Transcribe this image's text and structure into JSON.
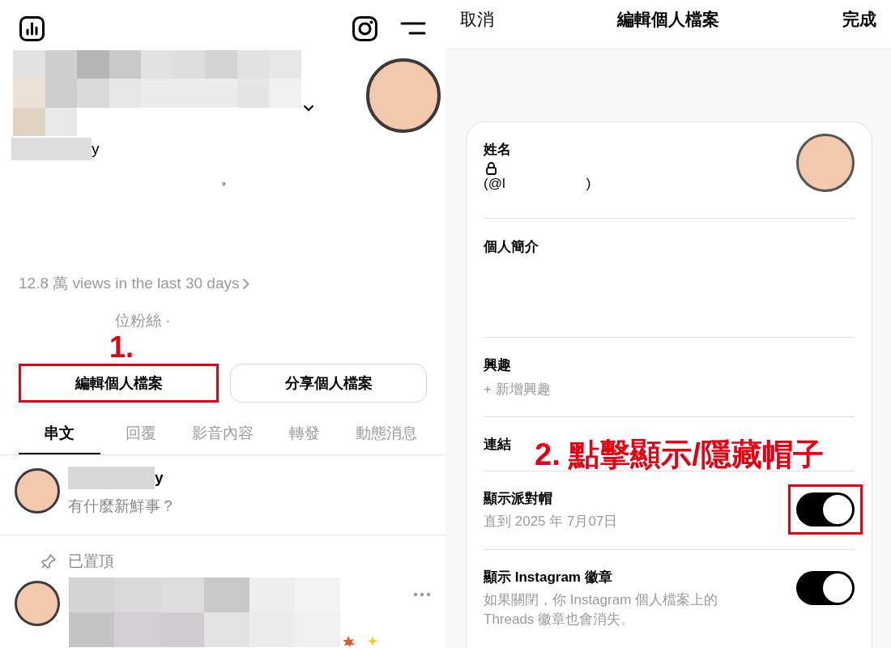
{
  "profile": {
    "name_suffix": "y",
    "bio": "。",
    "views": "12.8 萬 views in the last 30 days",
    "followers": "位粉絲 ·",
    "annotation": "1."
  },
  "profile_buttons": [
    {
      "label": "編輯個人檔案",
      "highlighted": true
    },
    {
      "label": "分享個人檔案",
      "highlighted": false
    }
  ],
  "tabs": [
    {
      "label": "串文",
      "selected": true
    },
    {
      "label": "回覆",
      "selected": false
    },
    {
      "label": "影音內容",
      "selected": false
    },
    {
      "label": "轉發",
      "selected": false
    },
    {
      "label": "動態消息",
      "selected": false
    }
  ],
  "composer": {
    "name_suffix": "y",
    "prompt": "有什麼新鮮事？"
  },
  "pinned": {
    "label": "已置頂"
  },
  "edit_profile": {
    "cancel": "取消",
    "title": "編輯個人檔案",
    "done": "完成",
    "name_label": "姓名",
    "handle_prefix": "(@l",
    "handle_suffix": ")",
    "bio_label": "個人簡介",
    "interests_label": "興趣",
    "add_interest": "+ 新增興趣",
    "links_label": "連結",
    "annotation": "2. 點擊顯示/隱藏帽子",
    "toggles": [
      {
        "title": "顯示派對帽",
        "subtitle": "直到 2025 年 7月07日",
        "on": true,
        "highlighted": true
      },
      {
        "title": "顯示 Instagram 徽章",
        "subtitle": "如果關閉，你 Instagram 個人檔案上的 Threads 徽章也會消失。",
        "on": true,
        "highlighted": false
      }
    ]
  }
}
